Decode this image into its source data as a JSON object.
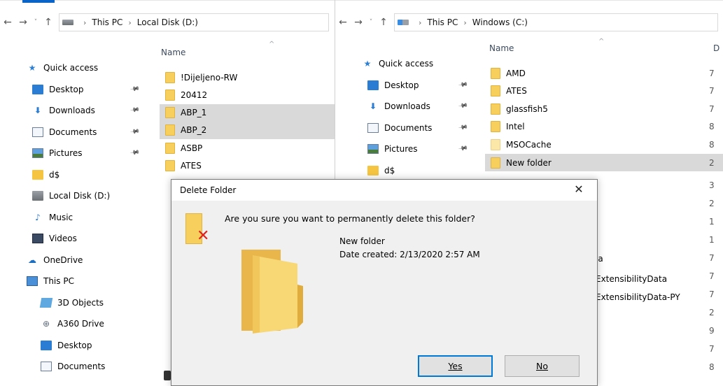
{
  "left_window": {
    "address": {
      "crumbs": [
        "This PC",
        "Local Disk (D:)"
      ]
    },
    "column_header": "Name",
    "nav": [
      {
        "label": "Quick access",
        "icon": "quick-access-star-icon",
        "pinned": false,
        "level": 0
      },
      {
        "label": "Desktop",
        "icon": "desktop-icon",
        "pinned": true,
        "level": 1
      },
      {
        "label": "Downloads",
        "icon": "downloads-icon",
        "pinned": true,
        "level": 1
      },
      {
        "label": "Documents",
        "icon": "documents-icon",
        "pinned": true,
        "level": 1
      },
      {
        "label": "Pictures",
        "icon": "pictures-icon",
        "pinned": true,
        "level": 1
      },
      {
        "label": "d$",
        "icon": "folder-icon",
        "pinned": false,
        "level": 1
      },
      {
        "label": "Local Disk (D:)",
        "icon": "drive-icon",
        "pinned": false,
        "level": 1
      },
      {
        "label": "Music",
        "icon": "music-icon",
        "pinned": false,
        "level": 1
      },
      {
        "label": "Videos",
        "icon": "videos-icon",
        "pinned": false,
        "level": 1
      },
      {
        "label": "OneDrive",
        "icon": "onedrive-icon",
        "pinned": false,
        "level": 0
      },
      {
        "label": "This PC",
        "icon": "this-pc-icon",
        "pinned": false,
        "level": 0
      },
      {
        "label": "3D Objects",
        "icon": "3d-objects-icon",
        "pinned": false,
        "level": 2
      },
      {
        "label": "A360 Drive",
        "icon": "a360-drive-icon",
        "pinned": false,
        "level": 2
      },
      {
        "label": "Desktop",
        "icon": "desktop-icon",
        "pinned": false,
        "level": 2
      },
      {
        "label": "Documents",
        "icon": "documents-icon",
        "pinned": false,
        "level": 2
      }
    ],
    "files": [
      {
        "name": "!Dijeljeno-RW",
        "selected": false
      },
      {
        "name": "20412",
        "selected": false
      },
      {
        "name": "ABP_1",
        "selected": true
      },
      {
        "name": "ABP_2",
        "selected": true
      },
      {
        "name": "ASBP",
        "selected": false
      },
      {
        "name": "ATES",
        "selected": false
      }
    ]
  },
  "right_window": {
    "address": {
      "crumbs": [
        "This PC",
        "Windows (C:)"
      ]
    },
    "column_header": "Name",
    "column_header_2": "D",
    "nav": [
      {
        "label": "Quick access",
        "icon": "quick-access-star-icon",
        "pinned": false,
        "level": 0
      },
      {
        "label": "Desktop",
        "icon": "desktop-icon",
        "pinned": true,
        "level": 1
      },
      {
        "label": "Downloads",
        "icon": "downloads-icon",
        "pinned": true,
        "level": 1
      },
      {
        "label": "Documents",
        "icon": "documents-icon",
        "pinned": true,
        "level": 1
      },
      {
        "label": "Pictures",
        "icon": "pictures-icon",
        "pinned": true,
        "level": 1
      },
      {
        "label": "d$",
        "icon": "folder-icon",
        "pinned": false,
        "level": 1
      }
    ],
    "files": [
      {
        "name": "AMD",
        "selected": false,
        "date_peek": "7"
      },
      {
        "name": "ATES",
        "selected": false,
        "date_peek": "7"
      },
      {
        "name": "glassfish5",
        "selected": false,
        "date_peek": "7"
      },
      {
        "name": "Intel",
        "selected": false,
        "date_peek": "8"
      },
      {
        "name": "MSOCache",
        "selected": false,
        "date_peek": "8"
      },
      {
        "name": "New folder",
        "selected": true,
        "date_peek": "2"
      }
    ],
    "peek_names": [
      "ia",
      "ExtensibilityData",
      "ExtensibilityData-PY"
    ],
    "peek_dates": [
      "3",
      "2",
      "1",
      "1",
      "7",
      "7",
      "7",
      "2",
      "9",
      "7",
      "8"
    ]
  },
  "dialog": {
    "title": "Delete Folder",
    "question": "Are you sure you want to permanently delete this folder?",
    "folder_name": "New folder",
    "date_created": "Date created: 2/13/2020 2:57 AM",
    "yes_label": "Yes",
    "no_label": "No"
  }
}
